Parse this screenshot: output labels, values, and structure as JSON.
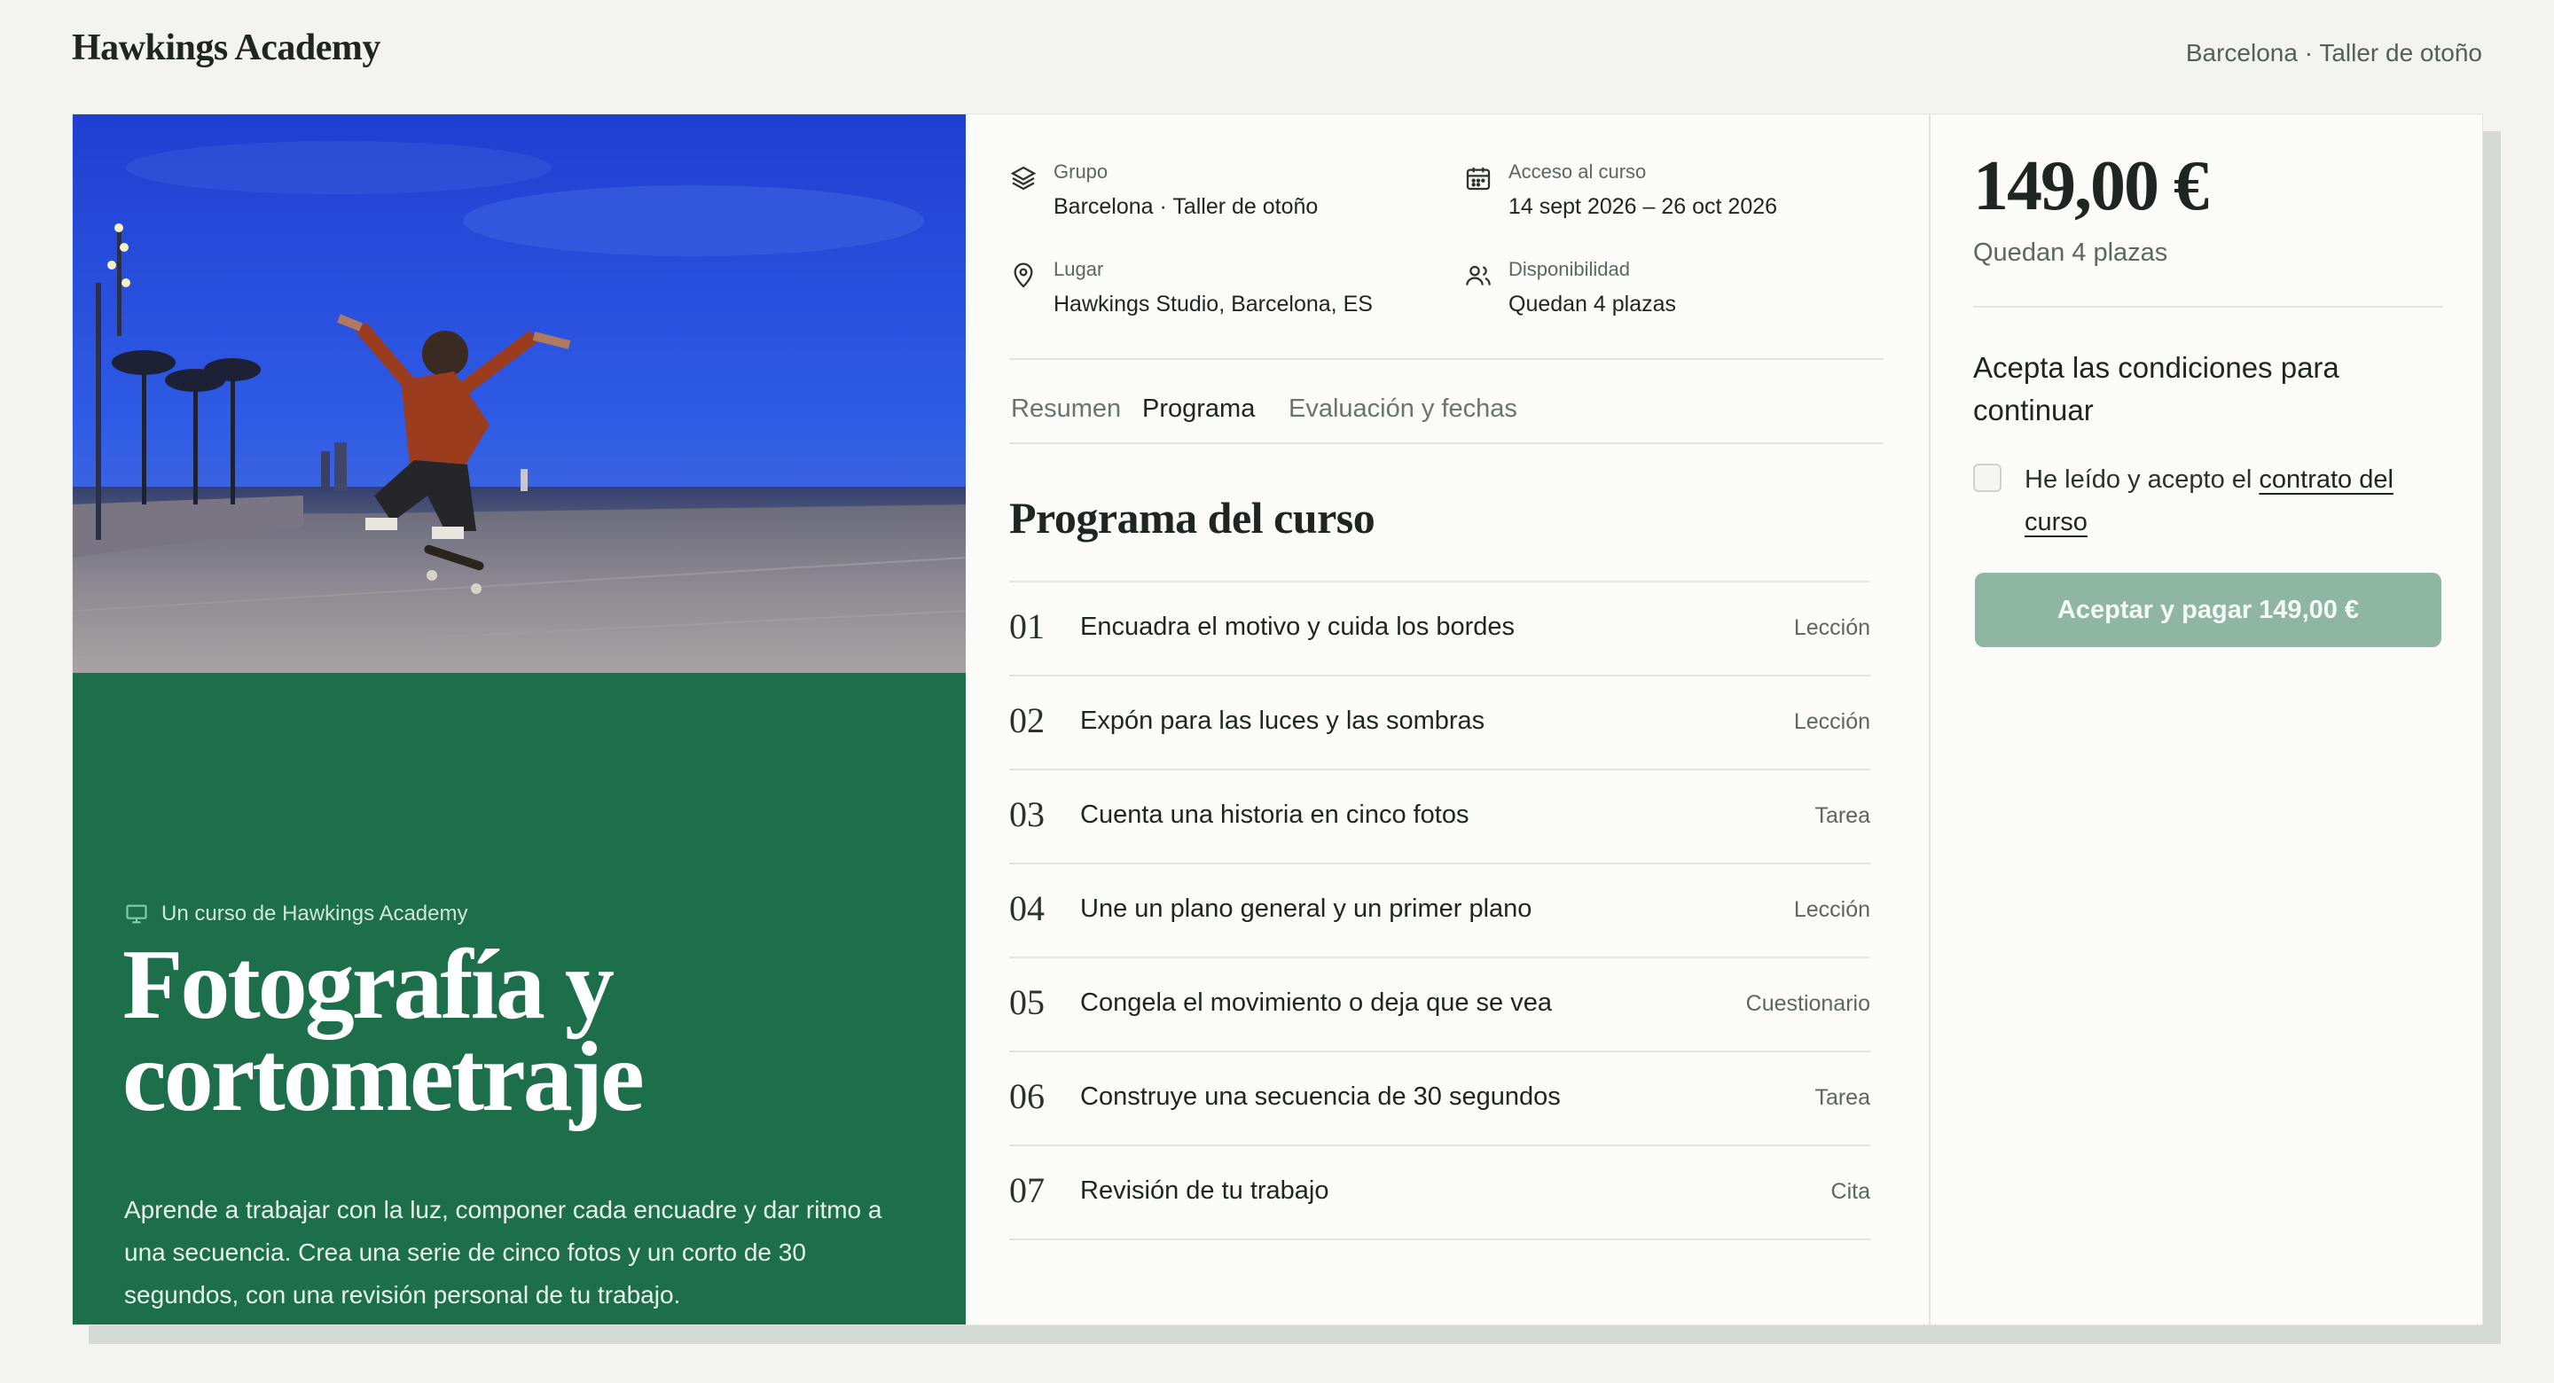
{
  "header": {
    "brand": "Hawkings Academy",
    "location_label": "Barcelona · Taller de otoño"
  },
  "hero": {
    "image_description_icon": "skateboarder-photo",
    "kicker": "Un curso de Hawkings Academy",
    "title": "Fotografía y cortometraje",
    "description": "Aprende a trabajar con la luz, componer cada encuadre y dar ritmo a una secuencia. Crea una serie de cinco fotos y un corto de 30 segundos, con una revisión personal de tu trabajo."
  },
  "meta": {
    "group": {
      "label": "Grupo",
      "value": "Barcelona · Taller de otoño",
      "icon": "layers-icon"
    },
    "access": {
      "label": "Acceso al curso",
      "value": "14 sept 2026 – 26 oct 2026",
      "icon": "calendar-icon"
    },
    "place": {
      "label": "Lugar",
      "value": "Hawkings Studio, Barcelona, ES",
      "icon": "map-pin-icon"
    },
    "availability": {
      "label": "Disponibilidad",
      "value": "Quedan 4 plazas",
      "icon": "users-icon"
    }
  },
  "tabs": [
    {
      "label": "Resumen",
      "active": false
    },
    {
      "label": "Programa",
      "active": true
    },
    {
      "label": "Evaluación y fechas",
      "active": false
    }
  ],
  "program": {
    "title": "Programa del curso",
    "lessons": [
      {
        "num": "01",
        "name": "Encuadra el motivo y cuida los bordes",
        "type": "Lección"
      },
      {
        "num": "02",
        "name": "Expón para las luces y las sombras",
        "type": "Lección"
      },
      {
        "num": "03",
        "name": "Cuenta una historia en cinco fotos",
        "type": "Tarea"
      },
      {
        "num": "04",
        "name": "Une un plano general y un primer plano",
        "type": "Lección"
      },
      {
        "num": "05",
        "name": "Congela el movimiento o deja que se vea",
        "type": "Cuestionario"
      },
      {
        "num": "06",
        "name": "Construye una secuencia de 30 segundos",
        "type": "Tarea"
      },
      {
        "num": "07",
        "name": "Revisión de tu trabajo",
        "type": "Cita"
      }
    ]
  },
  "purchase": {
    "price": "149,00 €",
    "seats_left": "Quedan 4 plazas",
    "accept_heading": "Acepta las condiciones para continuar",
    "checkbox_prefix": "He leído y acepto el ",
    "checkbox_link": "contrato del curso",
    "checkbox_checked": false,
    "pay_button": "Aceptar y pagar 149,00 €"
  },
  "colors": {
    "brand_green": "#1d6f4c",
    "button_disabled": "#8fb6a2",
    "background": "#f3f3ef"
  }
}
